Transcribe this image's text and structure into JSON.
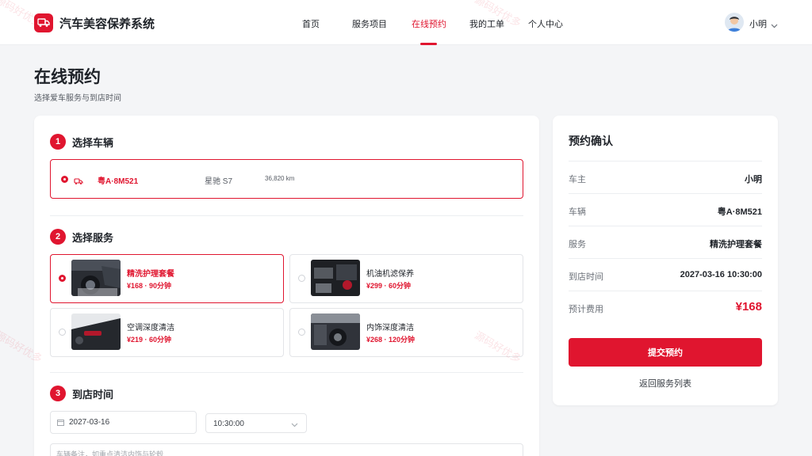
{
  "app": {
    "title": "汽车美容保养系统"
  },
  "nav": {
    "items": [
      {
        "label": "首页"
      },
      {
        "label": "服务项目"
      },
      {
        "label": "在线预约",
        "active": true
      },
      {
        "label": "我的工单"
      },
      {
        "label": "个人中心"
      }
    ]
  },
  "user": {
    "name": "小明"
  },
  "page": {
    "title": "在线预约",
    "subtitle": "选择爱车服务与到店时间"
  },
  "steps": {
    "vehicle": {
      "num": "1",
      "title": "选择车辆"
    },
    "service": {
      "num": "2",
      "title": "选择服务"
    },
    "time": {
      "num": "3",
      "title": "到店时间"
    }
  },
  "vehicle": {
    "plate": "粤A·8M521",
    "model": "星驰 S7",
    "mileage": "36,820 km",
    "selected": true
  },
  "services": [
    {
      "name": "精洗护理套餐",
      "price": "¥168 · 90分钟",
      "selected": true
    },
    {
      "name": "机油机滤保养",
      "price": "¥299 · 60分钟",
      "selected": false
    },
    {
      "name": "空调深度清洁",
      "price": "¥219 · 60分钟",
      "selected": false
    },
    {
      "name": "内饰深度清洁",
      "price": "¥268 · 120分钟",
      "selected": false
    }
  ],
  "time": {
    "date": "2027-03-16",
    "time": "10:30:00",
    "note_placeholder": "车辆备注，如重点清洁内饰与轮毂"
  },
  "confirm": {
    "title": "预约确认",
    "rows": [
      {
        "label": "车主",
        "value": "小明"
      },
      {
        "label": "车辆",
        "value": "粤A·8M521"
      },
      {
        "label": "服务",
        "value": "精洗护理套餐"
      },
      {
        "label": "到店时间",
        "value": "2027-03-16 10:30:00"
      },
      {
        "label": "预计费用",
        "value": "¥168"
      }
    ],
    "submit_label": "提交预约",
    "back_label": "返回服务列表"
  },
  "watermark": "源码好优多",
  "colors": {
    "accent": "#e0152f",
    "background": "#f4f5f7"
  },
  "icons": {
    "logo": "truck-icon",
    "vehicle": "car-icon",
    "date": "calendar-icon",
    "dropdown": "chevron-down-icon"
  }
}
